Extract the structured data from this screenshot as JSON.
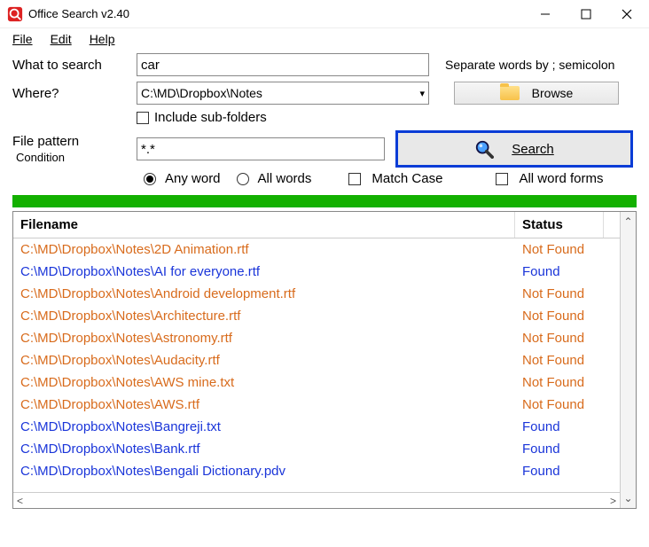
{
  "window": {
    "title": "Office Search v2.40"
  },
  "menu": {
    "file": "File",
    "edit": "Edit",
    "help": "Help"
  },
  "form": {
    "what_label": "What to search",
    "what_value": "car",
    "hint": "Separate words by ; semicolon",
    "where_label": "Where?",
    "where_value": "C:\\MD\\Dropbox\\Notes",
    "browse_label": "Browse",
    "include_sub_label": "Include sub-folders",
    "file_pattern_label": "File pattern",
    "file_pattern_value": "*.*",
    "search_label": "Search",
    "condition_label": "Condition",
    "any_word": "Any word",
    "all_words": "All words",
    "match_case": "Match Case",
    "all_forms": "All word forms"
  },
  "table": {
    "filename_header": "Filename",
    "status_header": "Status",
    "rows": [
      {
        "file": "C:\\MD\\Dropbox\\Notes\\2D Animation.rtf",
        "status": "Not Found",
        "found": false
      },
      {
        "file": "C:\\MD\\Dropbox\\Notes\\AI for everyone.rtf",
        "status": "Found",
        "found": true
      },
      {
        "file": "C:\\MD\\Dropbox\\Notes\\Android development.rtf",
        "status": "Not Found",
        "found": false
      },
      {
        "file": "C:\\MD\\Dropbox\\Notes\\Architecture.rtf",
        "status": "Not Found",
        "found": false
      },
      {
        "file": "C:\\MD\\Dropbox\\Notes\\Astronomy.rtf",
        "status": "Not Found",
        "found": false
      },
      {
        "file": "C:\\MD\\Dropbox\\Notes\\Audacity.rtf",
        "status": "Not Found",
        "found": false
      },
      {
        "file": "C:\\MD\\Dropbox\\Notes\\AWS mine.txt",
        "status": "Not Found",
        "found": false
      },
      {
        "file": "C:\\MD\\Dropbox\\Notes\\AWS.rtf",
        "status": "Not Found",
        "found": false
      },
      {
        "file": "C:\\MD\\Dropbox\\Notes\\Bangreji.txt",
        "status": "Found",
        "found": true
      },
      {
        "file": "C:\\MD\\Dropbox\\Notes\\Bank.rtf",
        "status": "Found",
        "found": true
      },
      {
        "file": "C:\\MD\\Dropbox\\Notes\\Bengali Dictionary.pdv",
        "status": "Found",
        "found": true
      }
    ]
  }
}
